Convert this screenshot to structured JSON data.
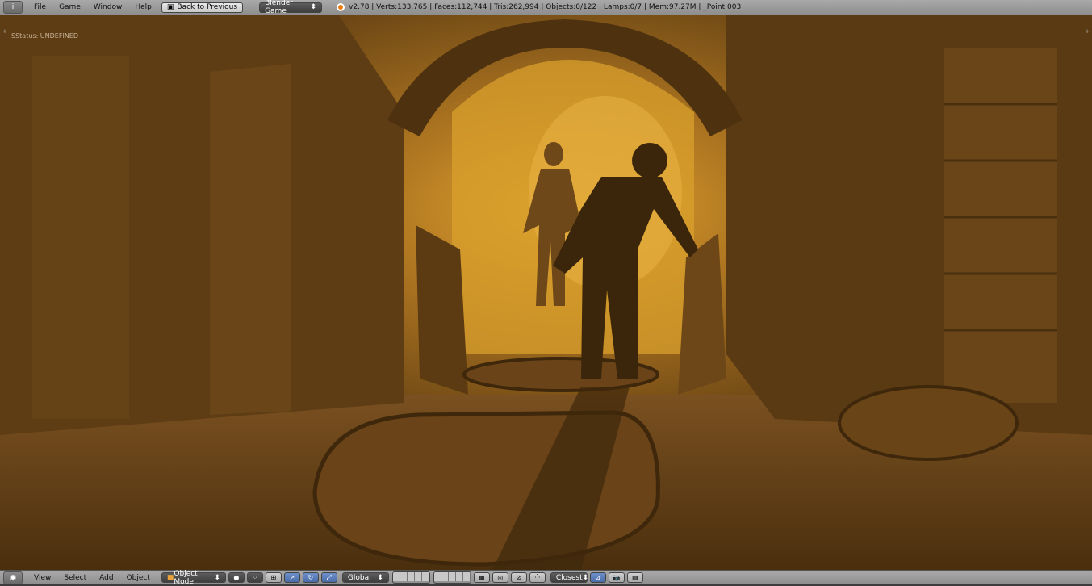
{
  "topbar": {
    "editor_icon": "info-editor-icon",
    "menu": [
      "File",
      "Game",
      "Window",
      "Help"
    ],
    "back_button": "Back to Previous",
    "engine": "Blender Game",
    "stats": "v2.78 | Verts:133,765 | Faces:112,744 | Tris:262,994 | Objects:0/122 | Lamps:0/7 | Mem:97.27M | _Point.003"
  },
  "viewport": {
    "status": "SStatus: UNDEFINED",
    "scene_colors": {
      "dark": "#5a3a12",
      "mid": "#7a5020",
      "bright": "#d49a2a"
    }
  },
  "bottombar": {
    "editor_icon": "3d-view-icon",
    "menu": [
      "View",
      "Select",
      "Add",
      "Object"
    ],
    "mode": "Object Mode",
    "orientation": "Global",
    "snap": "Closest"
  }
}
